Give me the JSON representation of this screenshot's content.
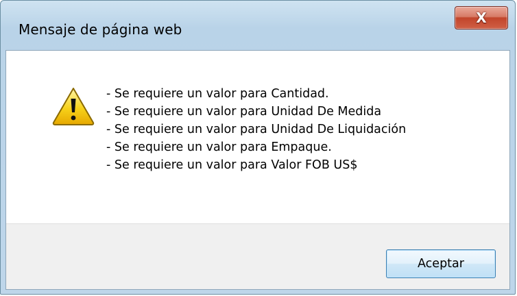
{
  "dialog": {
    "title": "Mensaje de página web",
    "close_label": "X",
    "messages": [
      "- Se requiere un valor para Cantidad.",
      "- Se requiere un valor para Unidad De Medida",
      "- Se requiere un valor para Unidad De Liquidación",
      "- Se requiere un valor para Empaque.",
      "- Se requiere un valor para Valor FOB US$"
    ],
    "icon": "warning-icon",
    "ok_label": "Aceptar"
  },
  "colors": {
    "title_bar": "#bed6ea",
    "close_button": "#c2452b",
    "ok_button_border": "#3c7fb1",
    "footer_bg": "#f0f0f0",
    "warning_yellow": "#f5c400"
  }
}
